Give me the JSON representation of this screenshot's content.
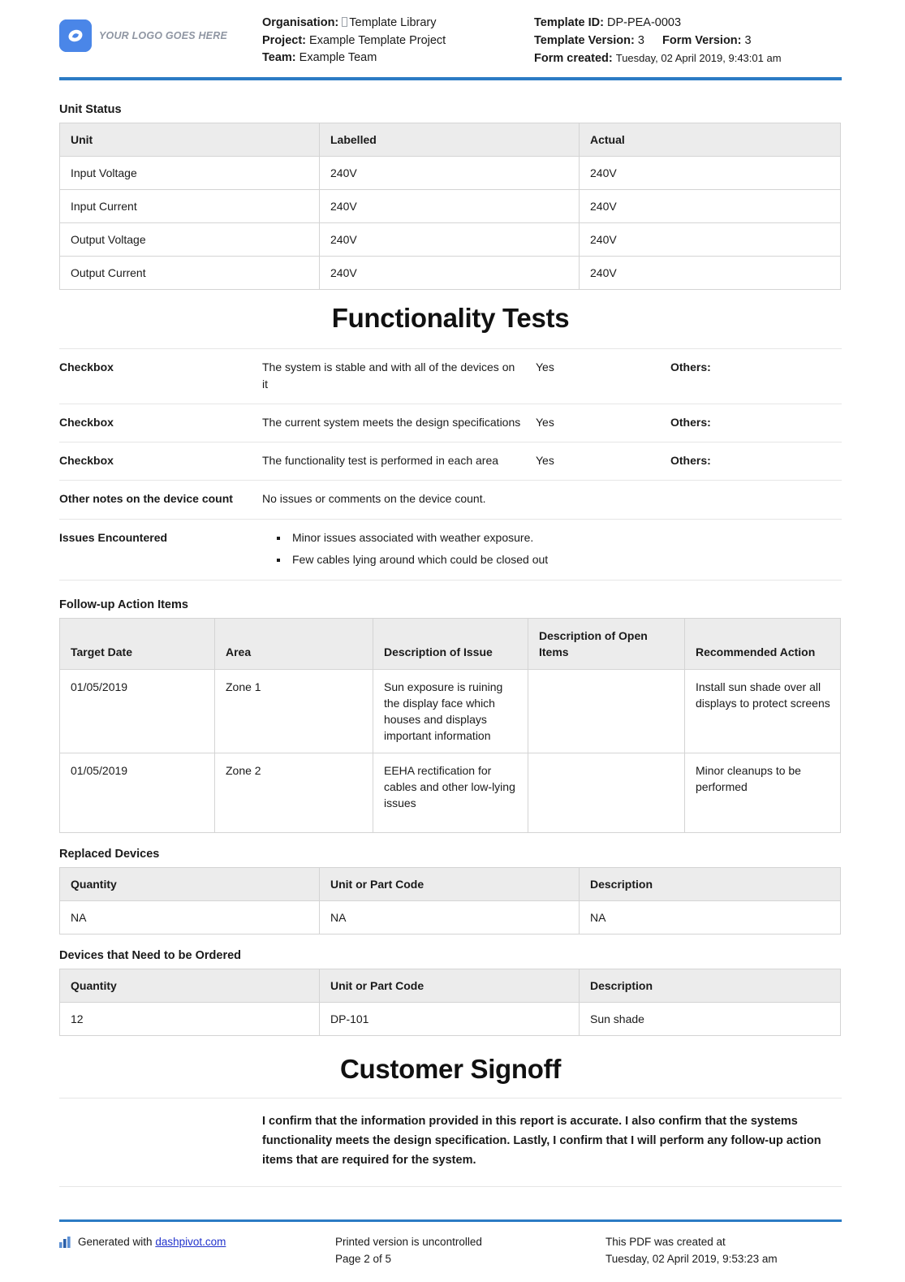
{
  "header": {
    "logo_text": "YOUR LOGO GOES HERE",
    "left": {
      "organisation_label": "Organisation:",
      "organisation_value": "Template Library",
      "project_label": "Project:",
      "project_value": "Example Template Project",
      "team_label": "Team:",
      "team_value": "Example Team"
    },
    "right": {
      "template_id_label": "Template ID:",
      "template_id_value": "DP-PEA-0003",
      "template_version_label": "Template Version:",
      "template_version_value": "3",
      "form_version_label": "Form Version:",
      "form_version_value": "3",
      "form_created_label": "Form created:",
      "form_created_value": "Tuesday, 02 April 2019, 9:43:01 am"
    }
  },
  "unit_status": {
    "title": "Unit Status",
    "columns": [
      "Unit",
      "Labelled",
      "Actual"
    ],
    "rows": [
      {
        "unit": "Input Voltage",
        "labelled": "240V",
        "actual": "240V"
      },
      {
        "unit": "Input Current",
        "labelled": "240V",
        "actual": "240V"
      },
      {
        "unit": "Output Voltage",
        "labelled": "240V",
        "actual": "240V"
      },
      {
        "unit": "Output Current",
        "labelled": "240V",
        "actual": "240V"
      }
    ]
  },
  "functionality_tests": {
    "heading": "Functionality Tests",
    "rows": [
      {
        "label": "Checkbox",
        "description": "The system is stable and with all of the devices on it",
        "answer": "Yes",
        "others_label": "Others:",
        "others_value": ""
      },
      {
        "label": "Checkbox",
        "description": "The current system meets the design specifications",
        "answer": "Yes",
        "others_label": "Others:",
        "others_value": ""
      },
      {
        "label": "Checkbox",
        "description": "The functionality test is performed in each area",
        "answer": "Yes",
        "others_label": "Others:",
        "others_value": ""
      }
    ],
    "other_notes": {
      "label": "Other notes on the device count",
      "value": "No issues or comments on the device count."
    },
    "issues_encountered": {
      "label": "Issues Encountered",
      "items": [
        "Minor issues associated with weather exposure.",
        "Few cables lying around which could be closed out"
      ]
    }
  },
  "followup": {
    "title": "Follow-up Action Items",
    "columns": [
      "Target Date",
      "Area",
      "Description of Issue",
      "Description of Open Items",
      "Recommended Action"
    ],
    "rows": [
      {
        "target_date": "01/05/2019",
        "area": "Zone 1",
        "description_of_issue": "Sun exposure is ruining the display face which houses and displays important information",
        "description_of_open_items": "",
        "recommended_action": "Install sun shade over all displays to protect screens"
      },
      {
        "target_date": "01/05/2019",
        "area": "Zone 2",
        "description_of_issue": "EEHA rectification for cables and other low-lying issues",
        "description_of_open_items": "",
        "recommended_action": "Minor cleanups to be performed"
      }
    ]
  },
  "replaced_devices": {
    "title": "Replaced Devices",
    "columns": [
      "Quantity",
      "Unit or Part Code",
      "Description"
    ],
    "rows": [
      {
        "quantity": "NA",
        "part_code": "NA",
        "description": "NA"
      }
    ]
  },
  "devices_to_order": {
    "title": "Devices that Need to be Ordered",
    "columns": [
      "Quantity",
      "Unit or Part Code",
      "Description"
    ],
    "rows": [
      {
        "quantity": "12",
        "part_code": "DP-101",
        "description": "Sun shade"
      }
    ]
  },
  "customer_signoff": {
    "heading": "Customer Signoff",
    "statement": "I confirm that the information provided in this report is accurate. I also confirm that the systems functionality meets the design specification. Lastly, I confirm that I will perform any follow-up action items that are required for the system."
  },
  "footer": {
    "generated_prefix": "Generated with",
    "generated_link": "dashpivot.com",
    "printed_notice": "Printed version is uncontrolled",
    "page_number": "Page 2 of 5",
    "pdf_created_label": "This PDF was created at",
    "pdf_created_value": "Tuesday, 02 April 2019, 9:53:23 am"
  },
  "colors": {
    "accent_blue": "#2b7bc4",
    "logo_blue": "#4a86e8",
    "table_header_bg": "#ececec",
    "link_blue": "#2233cc"
  }
}
